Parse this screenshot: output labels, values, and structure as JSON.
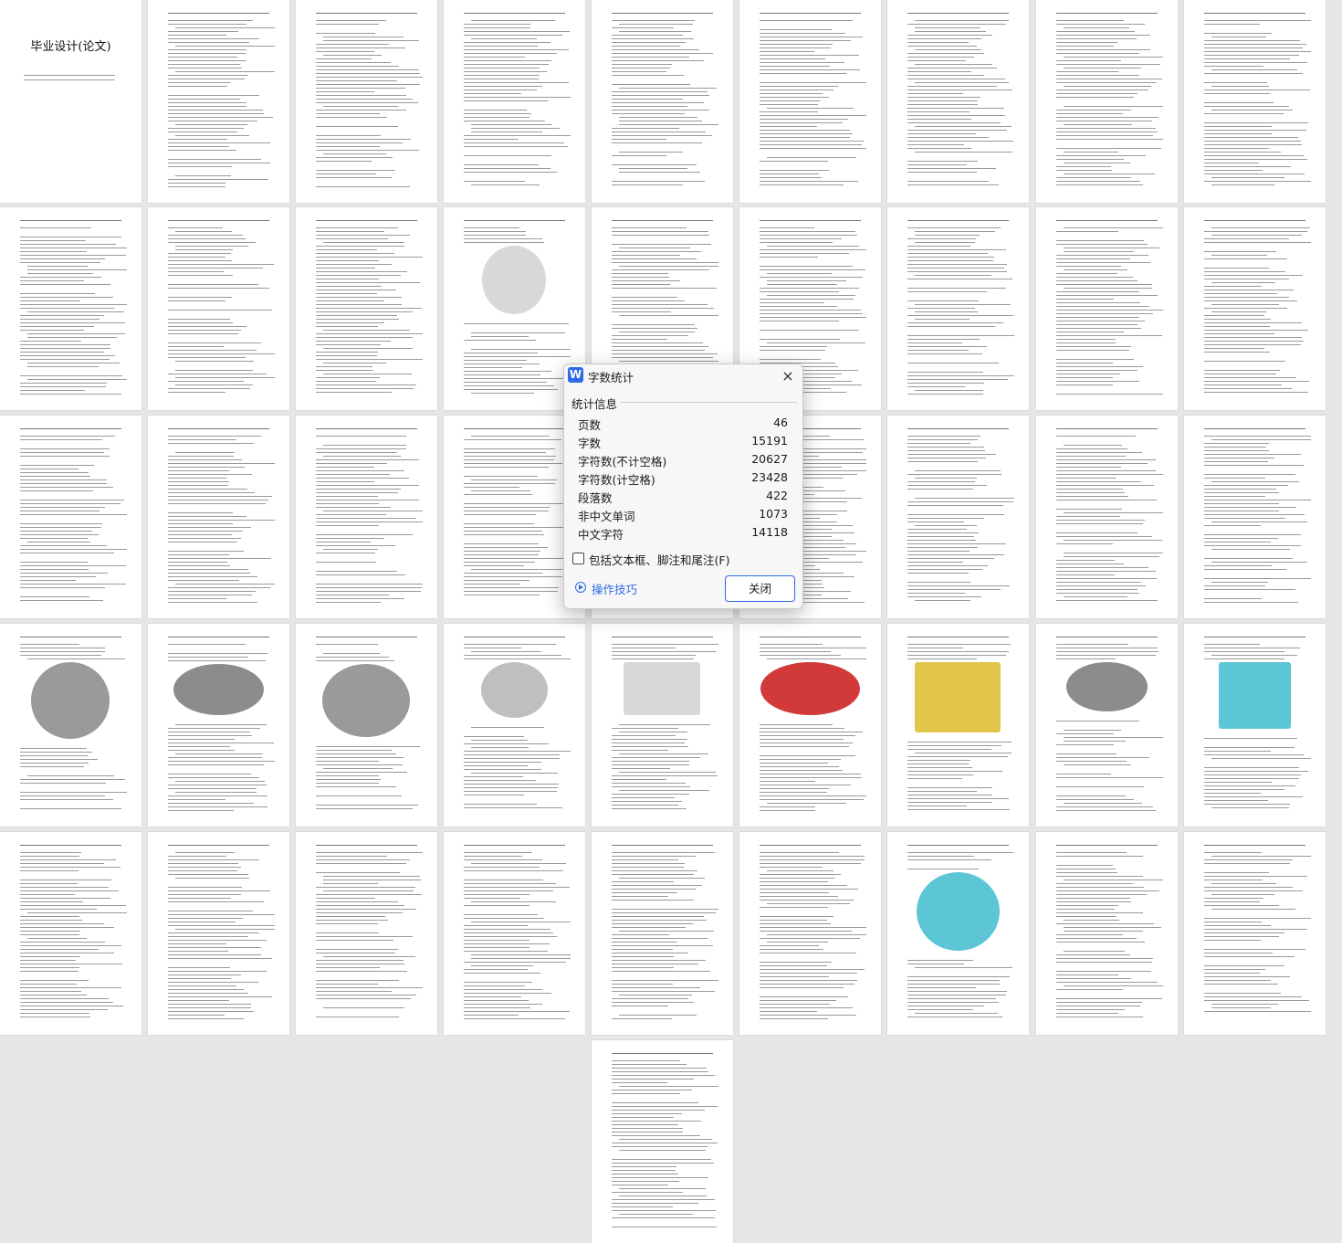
{
  "thumbnail_pages": [
    {
      "title": "毕业设计(论文)"
    }
  ],
  "dialog": {
    "app_logo": "W",
    "title": "字数统计",
    "close_icon": "×",
    "section_label": "统计信息",
    "stats": [
      {
        "label": "页数",
        "value": "46"
      },
      {
        "label": "字数",
        "value": "15191"
      },
      {
        "label": "字符数(不计空格)",
        "value": "20627"
      },
      {
        "label": "字符数(计空格)",
        "value": "23428"
      },
      {
        "label": "段落数",
        "value": "422"
      },
      {
        "label": "非中文单词",
        "value": "1073"
      },
      {
        "label": "中文字符",
        "value": "14118"
      }
    ],
    "include_textbox_label": "包括文本框、脚注和尾注(F)",
    "include_textbox_checked": false,
    "tips_label": "操作技巧",
    "close_button_label": "关闭"
  }
}
